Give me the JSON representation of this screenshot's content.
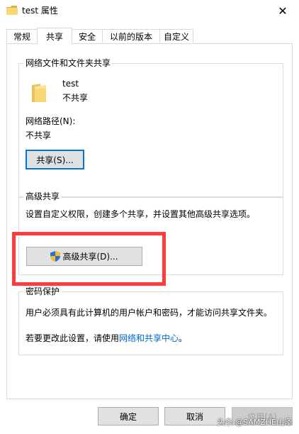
{
  "window": {
    "title": "test 属性",
    "close_glyph": "✕"
  },
  "tabs": [
    {
      "label": "常规"
    },
    {
      "label": "共享"
    },
    {
      "label": "安全"
    },
    {
      "label": "以前的版本"
    },
    {
      "label": "自定义"
    }
  ],
  "network_sharing": {
    "group_title": "网络文件和文件夹共享",
    "folder_name": "test",
    "folder_status": "不共享",
    "path_label": "网络路径(N):",
    "path_value": "不共享",
    "share_button": "共享(S)..."
  },
  "advanced_sharing": {
    "group_title": "高级共享",
    "description": "设置自定义权限，创建多个共享，并设置其他高级共享选项。",
    "button": "高级共享(D)..."
  },
  "password_protection": {
    "group_title": "密码保护",
    "line1": "用户必须具有此计算机的用户帐户和密码，才能访问共享文件夹。",
    "line2_prefix": "若要更改此设置，请使用",
    "line2_link": "网络和共享中心",
    "line2_suffix": "。"
  },
  "footer": {
    "ok": "确定",
    "cancel": "取消",
    "apply": "应用(A)"
  },
  "watermark": "头条 @SAMZHE山泽",
  "colors": {
    "accent": "#0078d7",
    "highlight": "#ff3b3b",
    "link": "#0066cc",
    "folder": "#f8d775"
  }
}
